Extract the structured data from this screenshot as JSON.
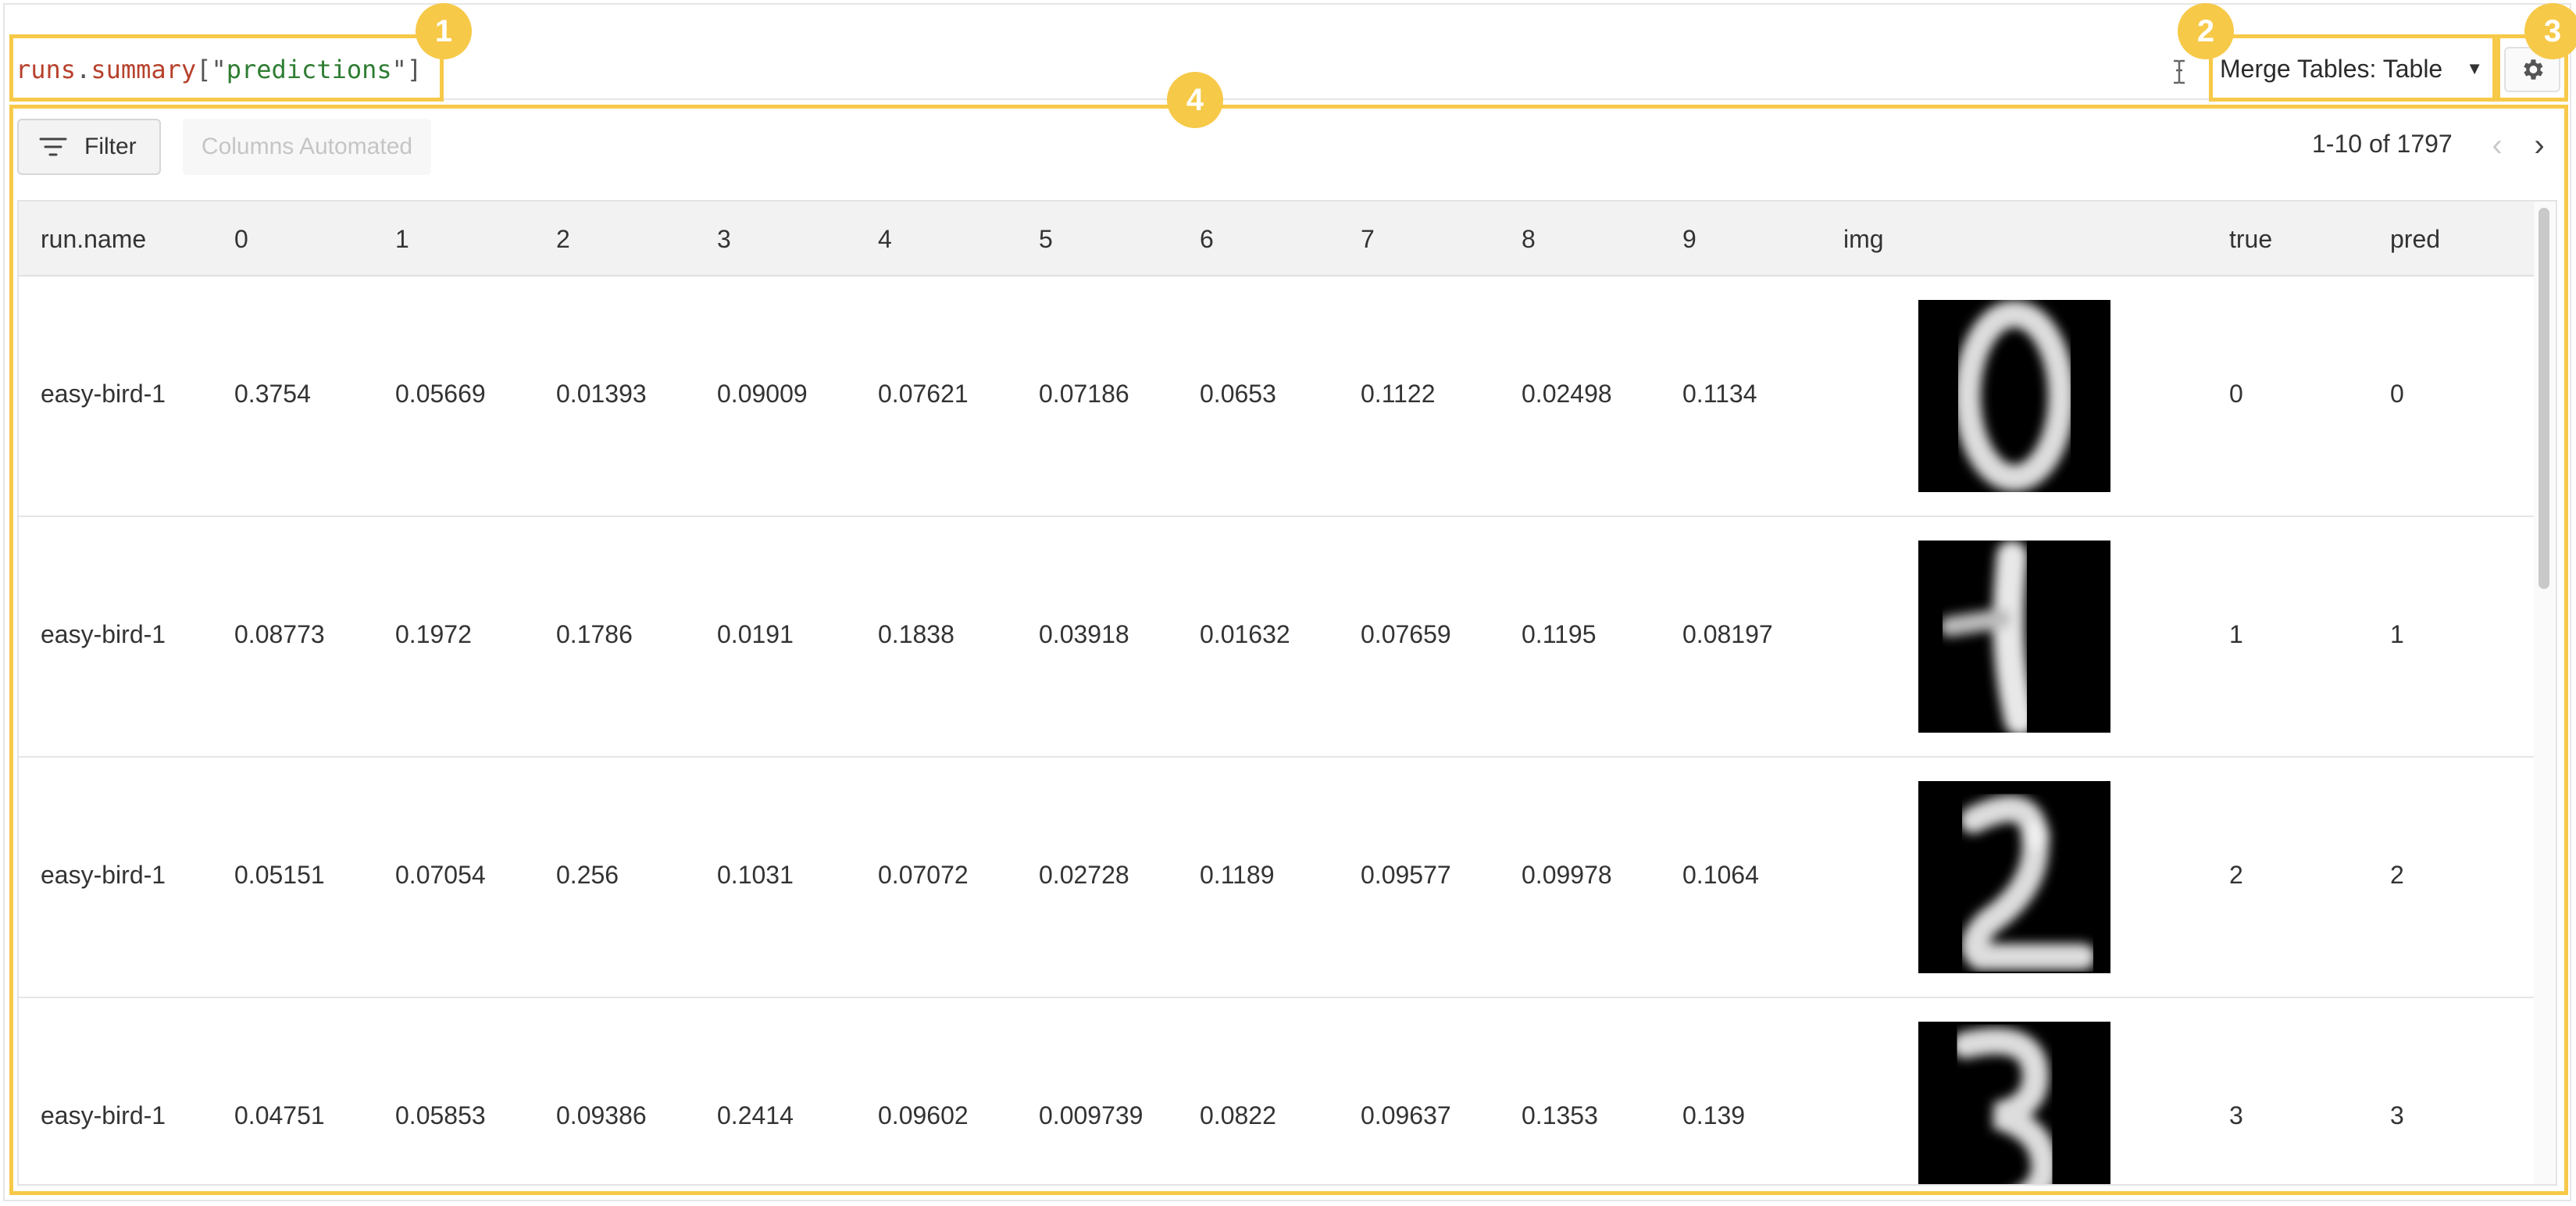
{
  "query": {
    "tokens": [
      {
        "text": "runs",
        "kind": "ident"
      },
      {
        "text": ".",
        "kind": "punc"
      },
      {
        "text": "summary",
        "kind": "attr"
      },
      {
        "text": "[\"",
        "kind": "punc"
      },
      {
        "text": "predictions",
        "kind": "str"
      },
      {
        "text": "\"]",
        "kind": "punc"
      }
    ]
  },
  "merge_select": {
    "label": "Merge Tables: Table"
  },
  "toolbar": {
    "filter_label": "Filter",
    "columns_label": "Columns Automated",
    "pager_text": "1-10 of 1797"
  },
  "badges": [
    "1",
    "2",
    "3",
    "4"
  ],
  "table": {
    "columns": [
      "run.name",
      "0",
      "1",
      "2",
      "3",
      "4",
      "5",
      "6",
      "7",
      "8",
      "9",
      "img",
      "true",
      "pred"
    ],
    "rows": [
      {
        "run": "easy-bird-1",
        "probs": [
          "0.3754",
          "0.05669",
          "0.01393",
          "0.09009",
          "0.07621",
          "0.07186",
          "0.0653",
          "0.1122",
          "0.02498",
          "0.1134"
        ],
        "img": "digit-0",
        "true": "0",
        "pred": "0"
      },
      {
        "run": "easy-bird-1",
        "probs": [
          "0.08773",
          "0.1972",
          "0.1786",
          "0.0191",
          "0.1838",
          "0.03918",
          "0.01632",
          "0.07659",
          "0.1195",
          "0.08197"
        ],
        "img": "digit-1",
        "true": "1",
        "pred": "1"
      },
      {
        "run": "easy-bird-1",
        "probs": [
          "0.05151",
          "0.07054",
          "0.256",
          "0.1031",
          "0.07072",
          "0.02728",
          "0.1189",
          "0.09577",
          "0.09978",
          "0.1064"
        ],
        "img": "digit-2",
        "true": "2",
        "pred": "2"
      },
      {
        "run": "easy-bird-1",
        "probs": [
          "0.04751",
          "0.05853",
          "0.09386",
          "0.2414",
          "0.09602",
          "0.009739",
          "0.0822",
          "0.09637",
          "0.1353",
          "0.139"
        ],
        "img": "digit-3",
        "true": "3",
        "pred": "3"
      }
    ]
  },
  "colors": {
    "highlight": "#f7c948",
    "code_ident": "#b7412c",
    "code_string": "#2e7d32"
  },
  "icons": {
    "filter": "filter-lines-icon",
    "gear": "gear-icon",
    "cursor": "text-cursor-icon",
    "prev": "chevron-left-icon",
    "next": "chevron-right-icon",
    "caret": "caret-down-icon"
  }
}
